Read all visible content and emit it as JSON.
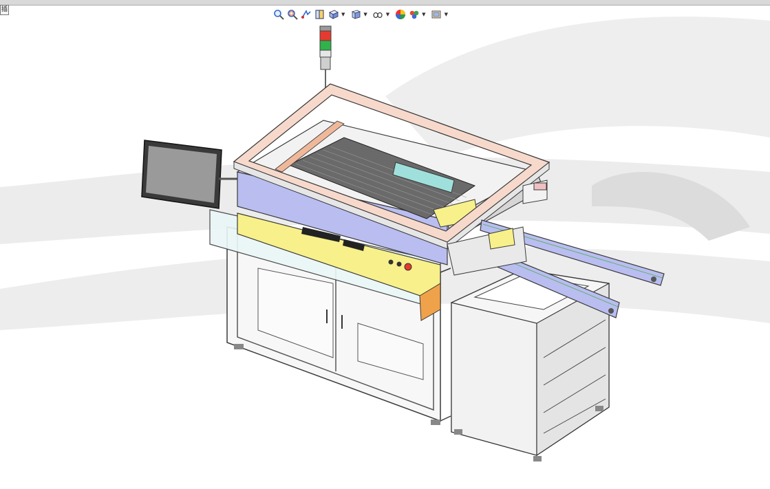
{
  "corner_button": {
    "label": "插"
  },
  "toolbar": {
    "items": [
      {
        "icon": "zoom-to-fit-icon"
      },
      {
        "icon": "zoom-to-area-icon"
      },
      {
        "icon": "previous-view-icon"
      },
      {
        "icon": "section-view-icon"
      },
      {
        "icon": "view-orientation-icon",
        "dropdown": true
      },
      {
        "icon": "display-style-icon",
        "dropdown": true
      },
      {
        "icon": "hide-show-items-icon",
        "dropdown": true
      },
      {
        "icon": "edit-appearance-icon"
      },
      {
        "icon": "apply-scene-icon",
        "dropdown": true
      },
      {
        "icon": "view-settings-icon",
        "dropdown": true
      }
    ]
  },
  "colors": {
    "frame_pink": "#f7d9cc",
    "accent_blue": "#b9bdf0",
    "panel_yellow": "#f8f08a",
    "aluminum": "#e6e6e6",
    "line": "#3a3a3a",
    "signal_red": "#e63a2e",
    "signal_green": "#2fb34a"
  }
}
